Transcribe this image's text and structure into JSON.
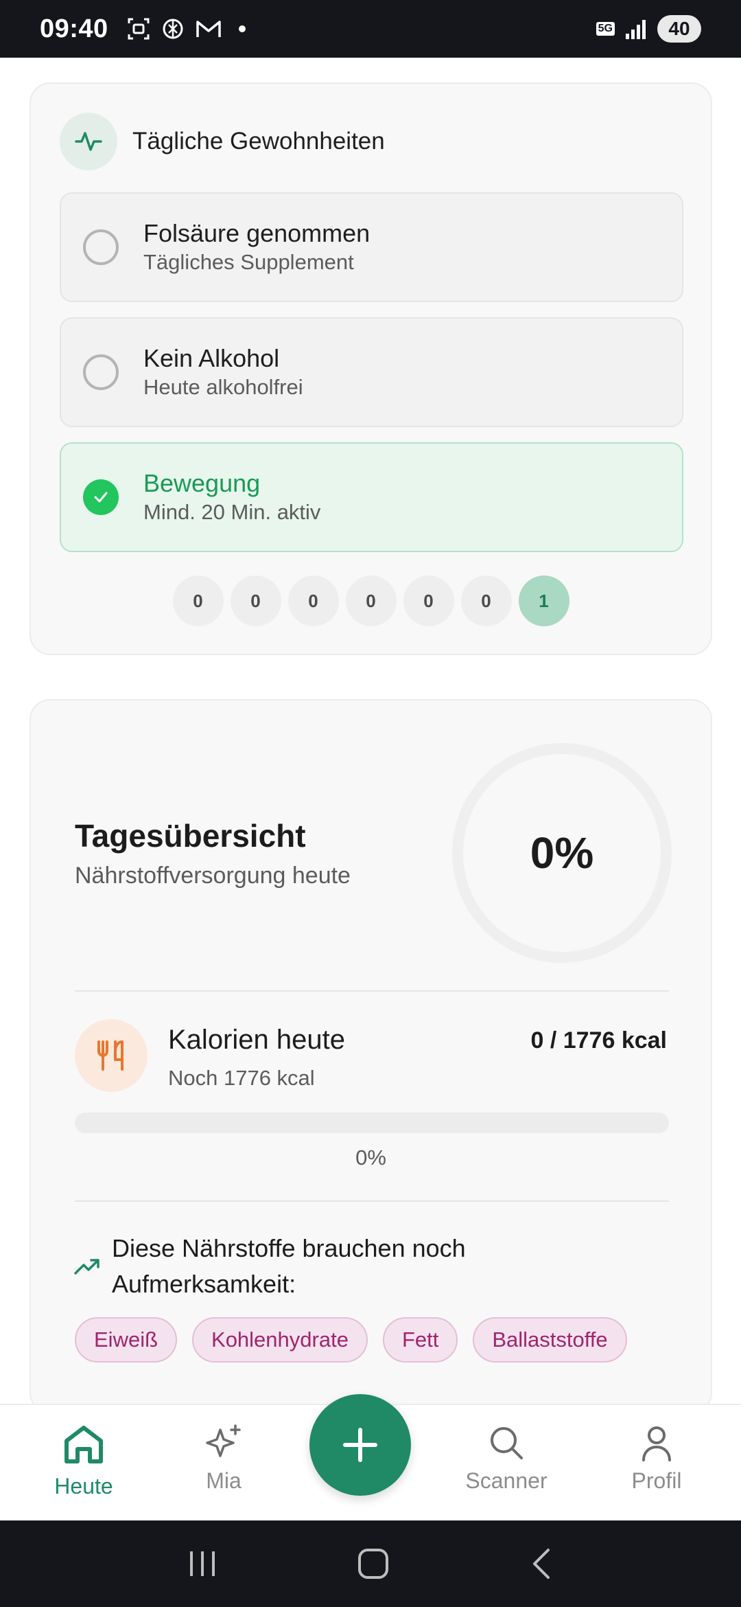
{
  "status_bar": {
    "time": "09:40",
    "network": "5G",
    "battery": "40"
  },
  "habits": {
    "title": "Tägliche Gewohnheiten",
    "items": [
      {
        "title": "Folsäure genommen",
        "subtitle": "Tägliches Supplement",
        "done": false
      },
      {
        "title": "Kein Alkohol",
        "subtitle": "Heute alkoholfrei",
        "done": false
      },
      {
        "title": "Bewegung",
        "subtitle": "Mind. 20 Min. aktiv",
        "done": true
      }
    ],
    "streak": [
      "0",
      "0",
      "0",
      "0",
      "0",
      "0",
      "1"
    ]
  },
  "overview": {
    "title": "Tagesübersicht",
    "subtitle": "Nährstoffversorgung heute",
    "ring_value": "0%",
    "ring_fraction": 0,
    "calories": {
      "title": "Kalorien heute",
      "subtitle": "Noch 1776 kcal",
      "value": "0 / 1776 kcal",
      "progress_label": "0%",
      "progress_fraction": 0
    },
    "attention": {
      "text": "Diese Nährstoffe brauchen noch Aufmerksamkeit:",
      "chips": [
        "Eiweiß",
        "Kohlenhydrate",
        "Fett",
        "Ballaststoffe"
      ]
    }
  },
  "bottom_nav": {
    "items": [
      {
        "label": "Heute",
        "icon": "home-icon",
        "active": true
      },
      {
        "label": "Mia",
        "icon": "sparkles-icon",
        "active": false
      },
      {
        "label": "Scanner",
        "icon": "search-icon",
        "active": false
      },
      {
        "label": "Profil",
        "icon": "user-icon",
        "active": false
      }
    ],
    "fab_icon": "plus-icon"
  },
  "colors": {
    "accent": "#1f8a65",
    "success": "#22c55e",
    "chip_text": "#a0246f",
    "calorie_icon": "#e8772e"
  }
}
